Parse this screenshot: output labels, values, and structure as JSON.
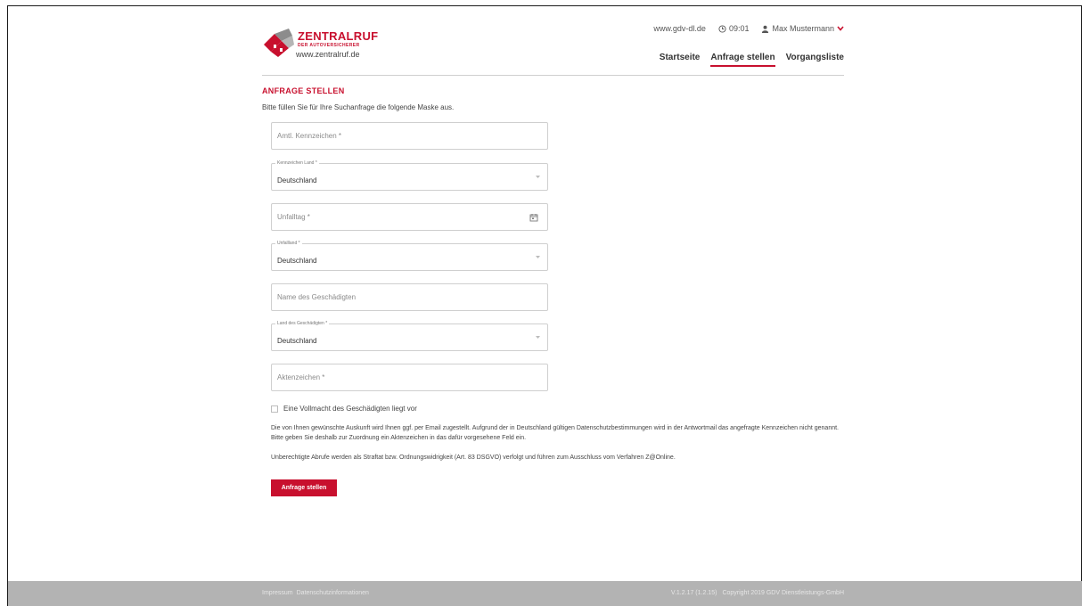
{
  "brand": {
    "name": "ZENTRALRUF",
    "subline": "DER AUTOVERSICHERER",
    "url": "www.zentralruf.de",
    "color": "#c8102e"
  },
  "top_bar": {
    "site": "www.gdv-dl.de",
    "time": "09:01",
    "user": "Max Mustermann"
  },
  "nav": {
    "items": [
      "Startseite",
      "Anfrage stellen",
      "Vorgangsliste"
    ],
    "active": "Anfrage stellen"
  },
  "page": {
    "title": "ANFRAGE STELLEN",
    "intro": "Bitte füllen Sie für Ihre Suchanfrage die folgende Maske aus."
  },
  "form": {
    "kennzeichen": {
      "placeholder": "Amtl. Kennzeichen *"
    },
    "kennzeichen_land": {
      "label": "Kennzeichen Land *",
      "value": "Deutschland"
    },
    "unfalltag": {
      "placeholder": "Unfalltag *"
    },
    "unfallland": {
      "label": "Unfallland *",
      "value": "Deutschland"
    },
    "geschaedigter_name": {
      "placeholder": "Name des Geschädigten"
    },
    "geschaedigter_land": {
      "label": "Land des Geschädigten *",
      "value": "Deutschland"
    },
    "aktenzeichen": {
      "placeholder": "Aktenzeichen *"
    },
    "vollmacht_label": "Eine Vollmacht des Geschädigten liegt vor",
    "notice_1": "Die von Ihnen gewünschte Auskunft wird Ihnen ggf. per Email zugestellt. Aufgrund der in Deutschland gültigen Datenschutzbestimmungen wird in der Antwortmail das angefragte Kennzeichen nicht genannt. Bitte geben Sie deshalb zur Zuordnung ein Aktenzeichen in das dafür vorgesehene Feld ein.",
    "notice_2": "Unberechtigte Abrufe werden als Straftat bzw. Ordnungswidrigkeit (Art. 83 DSGVO) verfolgt und führen zum Ausschluss vom Verfahren Z@Online.",
    "submit_label": "Anfrage stellen"
  },
  "footer": {
    "impressum": "Impressum",
    "datenschutz": "Datenschutzinformationen",
    "version": "V.1.2.17 (1.2.15)",
    "copyright": "Copyright 2019 GDV Dienstleistungs-GmbH"
  }
}
